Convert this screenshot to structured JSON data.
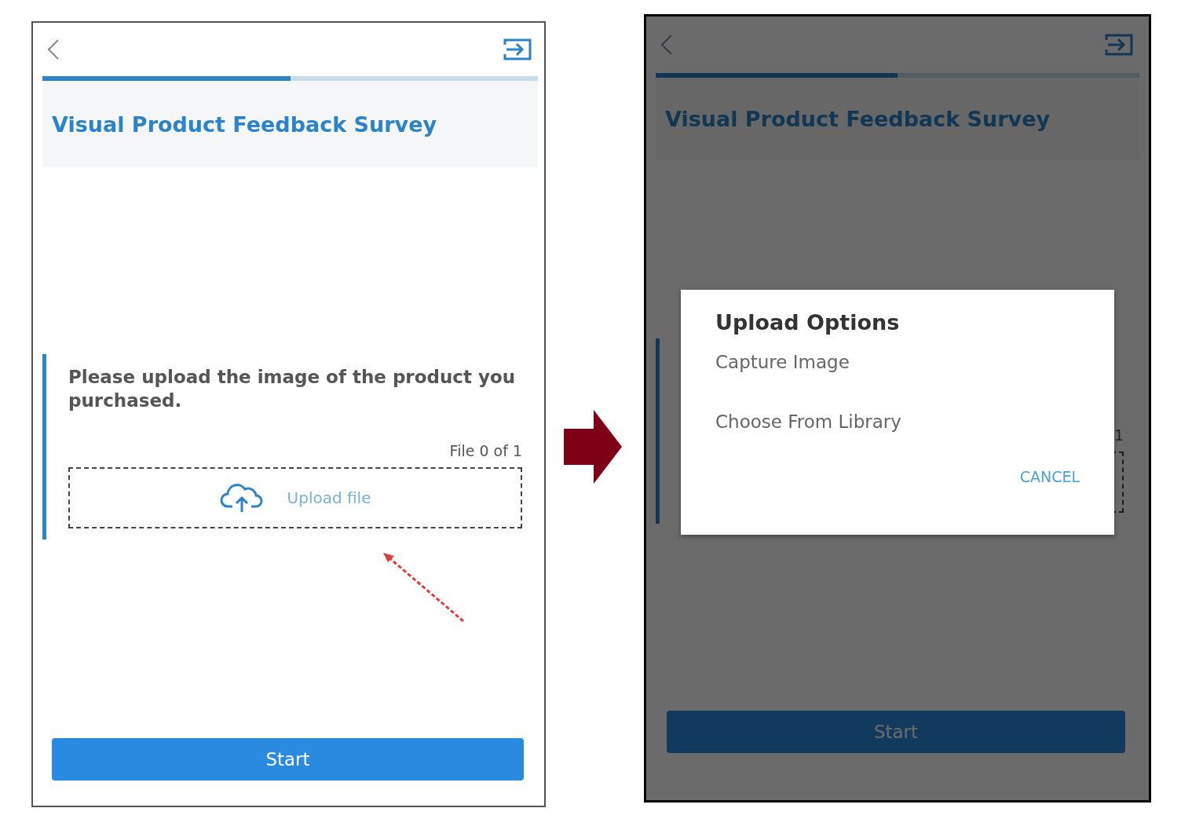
{
  "screens": [
    {
      "kind": "form",
      "title": "Visual Product Feedback Survey",
      "progress": {
        "level": 0.5
      },
      "question": "Please upload the image of the product you purchased.",
      "file_count": "File 0 of 1",
      "upload_label": "Upload file",
      "start_button": "Start"
    },
    {
      "kind": "dialog",
      "title": "Visual Product Feedback Survey",
      "progress": {
        "level": 0.5
      },
      "file_count": "1",
      "start_button": "Start",
      "dialog": {
        "title": "Upload Options",
        "options": [
          "Capture Image",
          "Choose From Library"
        ],
        "cancel": "CANCEL"
      }
    }
  ]
}
